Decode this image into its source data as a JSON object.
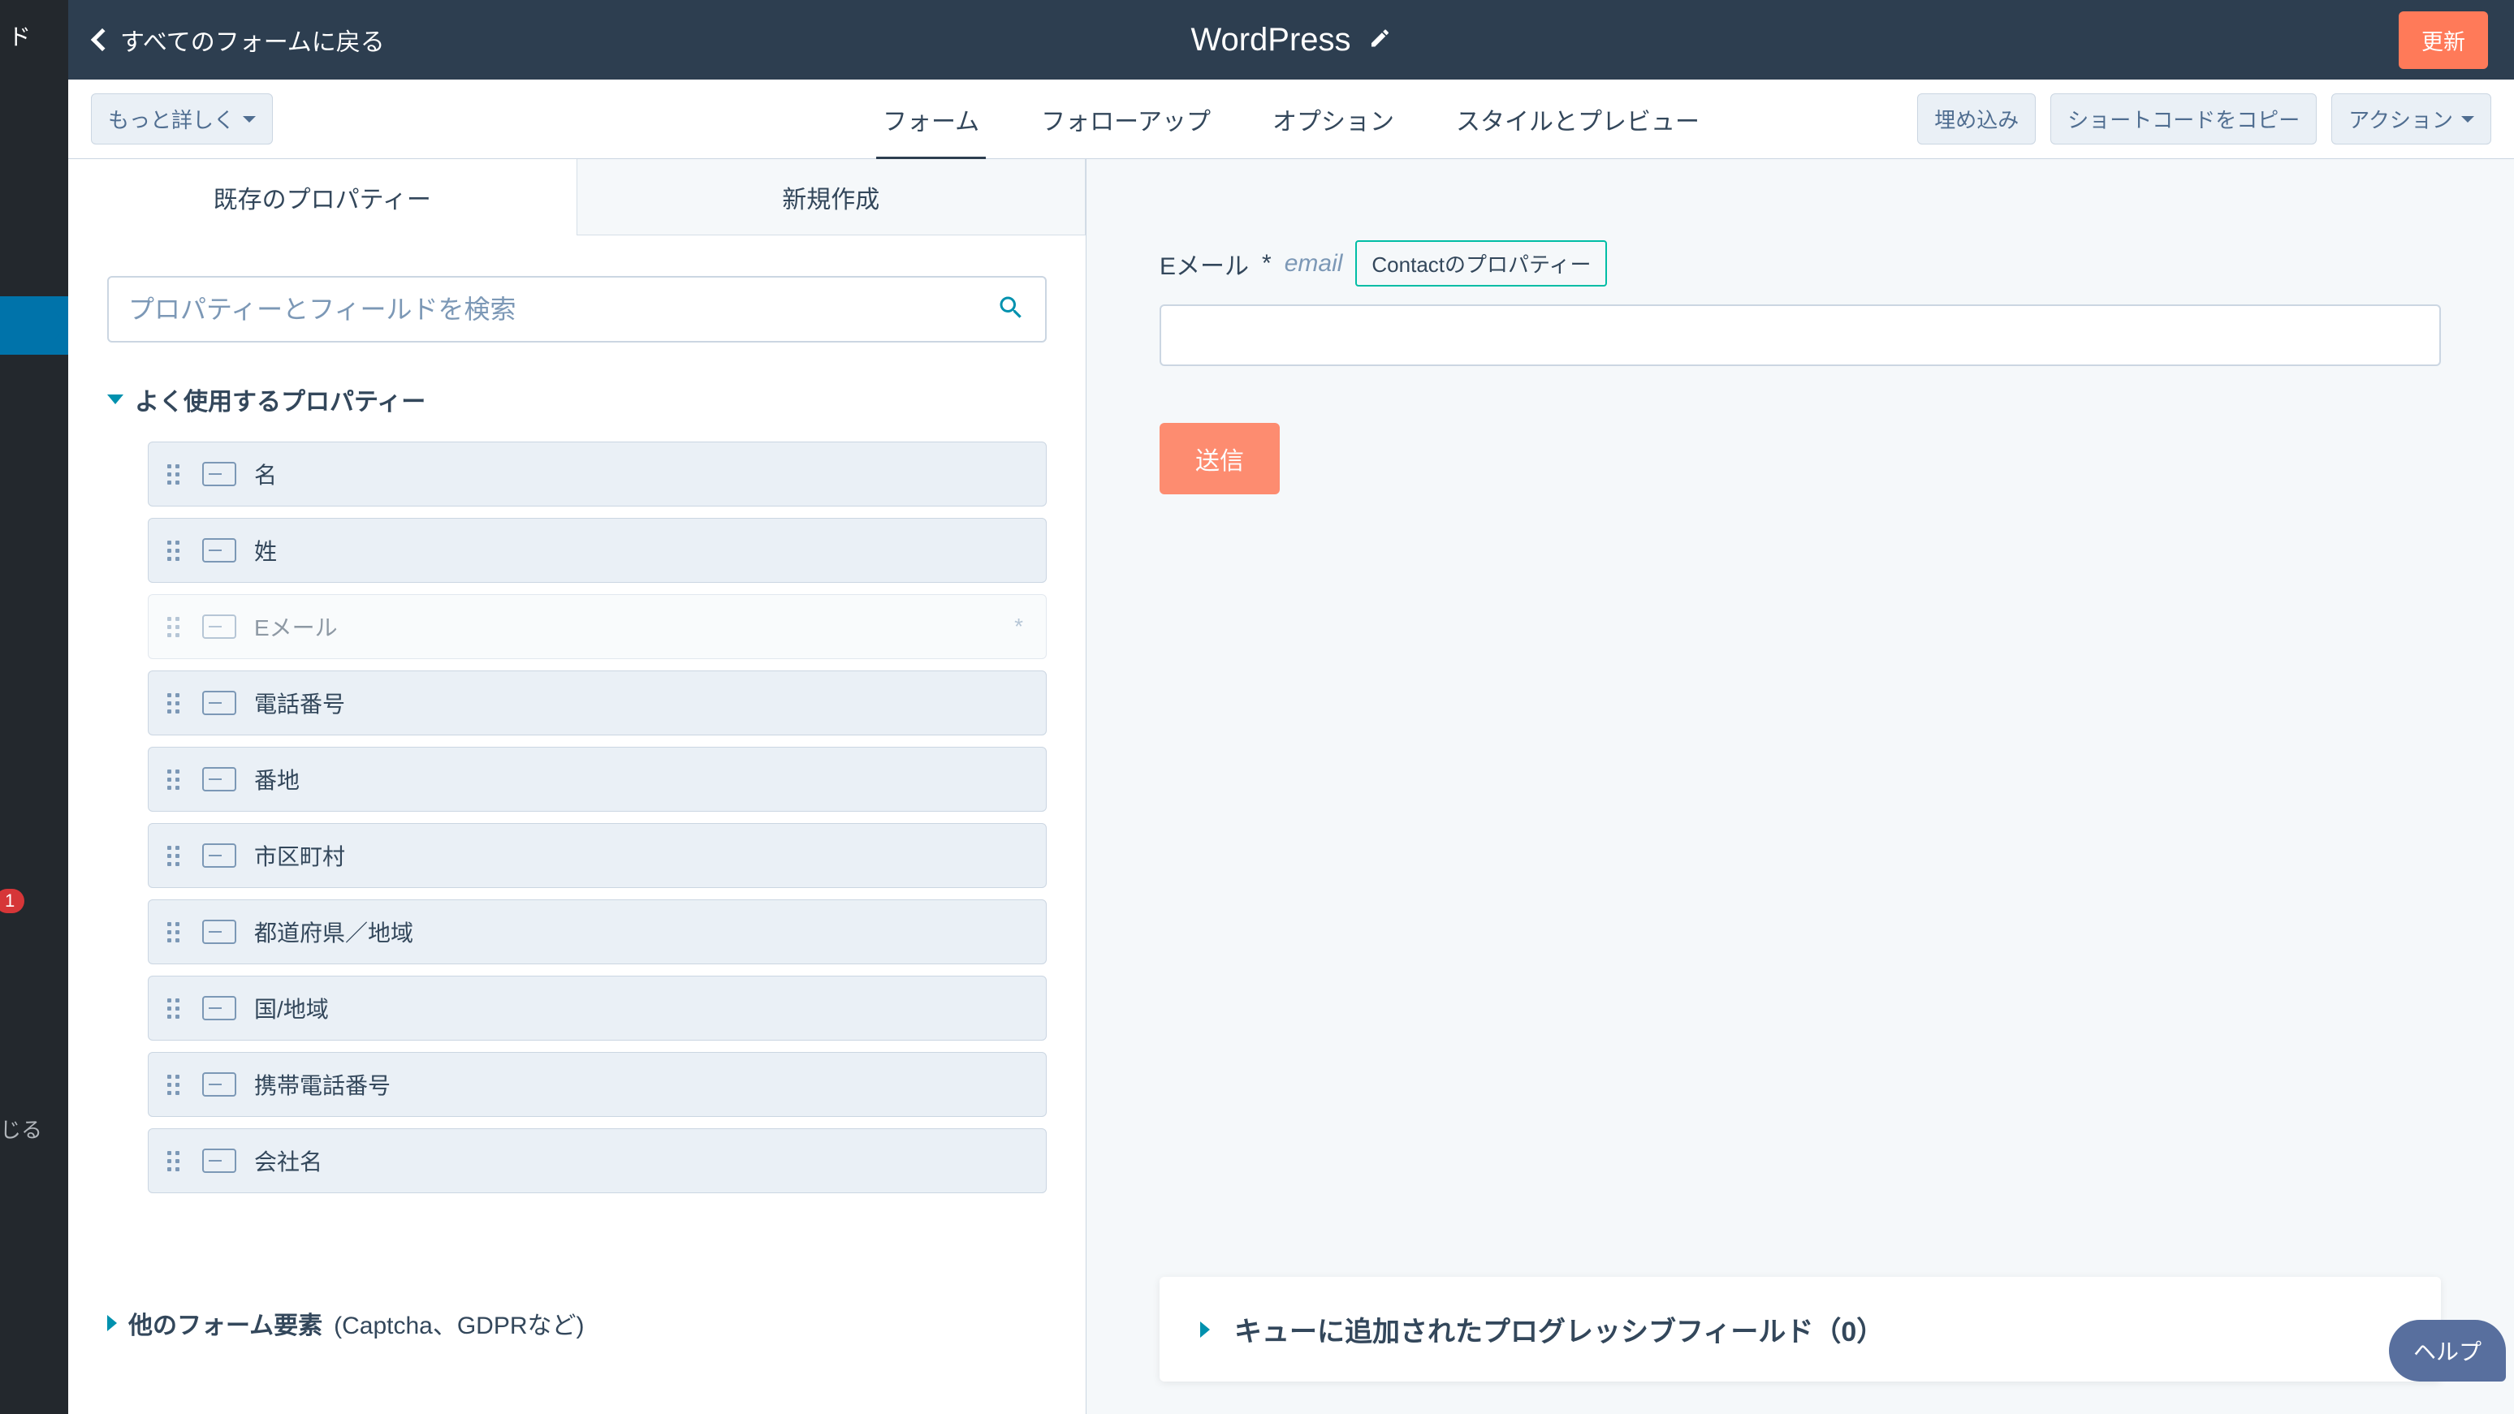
{
  "wp_sidebar": {
    "partial_text": "ド",
    "badge": "1",
    "collapse_text": "じる"
  },
  "header": {
    "back_label": "すべてのフォームに戻る",
    "title": "WordPress",
    "update_label": "更新"
  },
  "tabbar": {
    "more_detail": "もっと詳しく",
    "tabs": [
      "フォーム",
      "フォローアップ",
      "オプション",
      "スタイルとプレビュー"
    ],
    "action_embed": "埋め込み",
    "action_copy_shortcode": "ショートコードをコピー",
    "action_menu": "アクション"
  },
  "panel_tabs": {
    "existing": "既存のプロパティー",
    "create_new": "新規作成"
  },
  "search": {
    "placeholder": "プロパティーとフィールドを検索"
  },
  "frequent_section": {
    "title": "よく使用するプロパティー",
    "items": [
      {
        "label": "名",
        "disabled": false,
        "required": false
      },
      {
        "label": "姓",
        "disabled": false,
        "required": false
      },
      {
        "label": "Eメール",
        "disabled": true,
        "required": true
      },
      {
        "label": "電話番号",
        "disabled": false,
        "required": false
      },
      {
        "label": "番地",
        "disabled": false,
        "required": false
      },
      {
        "label": "市区町村",
        "disabled": false,
        "required": false
      },
      {
        "label": "都道府県／地域",
        "disabled": false,
        "required": false
      },
      {
        "label": "国/地域",
        "disabled": false,
        "required": false
      },
      {
        "label": "携帯電話番号",
        "disabled": false,
        "required": false
      },
      {
        "label": "会社名",
        "disabled": false,
        "required": false
      }
    ]
  },
  "other_elements": {
    "title": "他のフォーム要素",
    "subtitle": "(Captcha、GDPRなど)"
  },
  "form_preview": {
    "email_label": "Eメール",
    "required_mark": "*",
    "email_apiname": "email",
    "email_tag": "Contactのプロパティー",
    "submit_label": "送信"
  },
  "progressive": {
    "title": "キューに追加されたプログレッシブフィールド（0）"
  },
  "help": {
    "label": "ヘルプ"
  }
}
